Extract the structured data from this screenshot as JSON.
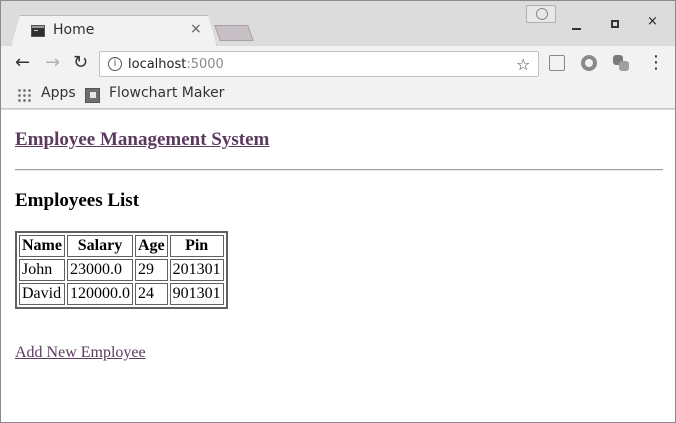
{
  "browser": {
    "tab": {
      "title": "Home",
      "close_glyph": "×"
    },
    "window_controls": {
      "profile_icon": "person-icon",
      "close_glyph": "×"
    },
    "toolbar": {
      "back_glyph": "←",
      "forward_glyph": "→",
      "reload_glyph": "↻",
      "star_glyph": "☆",
      "menu_glyph": "⋮"
    },
    "omnibox": {
      "info_glyph": "i",
      "url_host": "localhost",
      "url_port": ":5000"
    },
    "bookmarks": [
      {
        "label": "Apps",
        "icon": "apps-grid-icon"
      },
      {
        "label": "Flowchart Maker",
        "icon": "flowchart-icon"
      }
    ]
  },
  "page": {
    "site_title": "Employee Management System",
    "list_heading": "Employees List",
    "table": {
      "headers": [
        "Name",
        "Salary",
        "Age",
        "Pin"
      ],
      "rows": [
        [
          "John",
          "23000.0",
          "29",
          "201301"
        ],
        [
          "David",
          "120000.0",
          "24",
          "901301"
        ]
      ]
    },
    "add_link": "Add New Employee"
  },
  "colors": {
    "link_visited": "#5b3a5e",
    "tabstrip_bg": "#dcdcdc",
    "toolbar_bg": "#f2f2f2"
  }
}
